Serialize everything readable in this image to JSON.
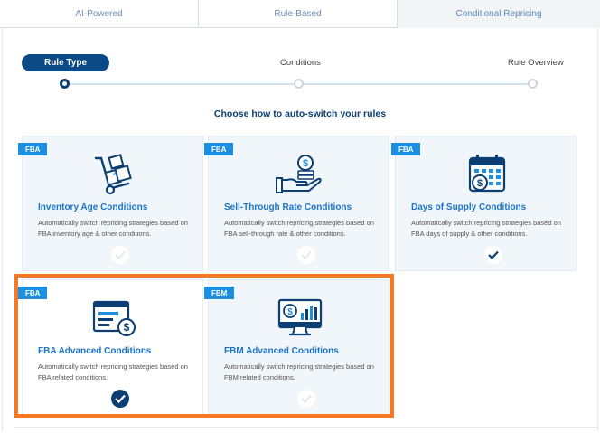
{
  "tabs": [
    {
      "label": "AI-Powered"
    },
    {
      "label": "Rule-Based"
    },
    {
      "label": "Conditional Repricing"
    }
  ],
  "stepper": {
    "steps": [
      {
        "label": "Rule Type"
      },
      {
        "label": "Conditions"
      },
      {
        "label": "Rule Overview"
      }
    ]
  },
  "subtitle": "Choose how to auto-switch your rules",
  "cards": [
    {
      "badge": "FBA",
      "title": "Inventory Age Conditions",
      "desc": "Automatically switch repricing strategies based on FBA inventory age & other conditions.",
      "icon": "hand-truck-boxes-icon",
      "selected": false
    },
    {
      "badge": "FBA",
      "title": "Sell-Through Rate Conditions",
      "desc": "Automatically switch repricing strategies based on FBA sell-through rate & other conditions.",
      "icon": "hand-coins-icon",
      "selected": false
    },
    {
      "badge": "FBA",
      "title": "Days of Supply Conditions",
      "desc": "Automatically switch repricing strategies based on FBA days of supply & other conditions.",
      "icon": "calendar-dollar-icon",
      "selected": false
    },
    {
      "badge": "FBA",
      "title": "FBA Advanced Conditions",
      "desc": "Automatically switch repricing strategies based on FBA related conditions.",
      "icon": "browser-dollar-icon",
      "selected": true
    },
    {
      "badge": "FBM",
      "title": "FBM Advanced Conditions",
      "desc": "Automatically switch repricing strategies based on FBM related conditions.",
      "icon": "monitor-chart-icon",
      "selected": false
    }
  ],
  "colors": {
    "primary": "#0b3f73",
    "accent": "#1b73c8",
    "badge": "#1d8fe0",
    "highlight": "#f47920",
    "card_bg": "#f1f6fb"
  }
}
